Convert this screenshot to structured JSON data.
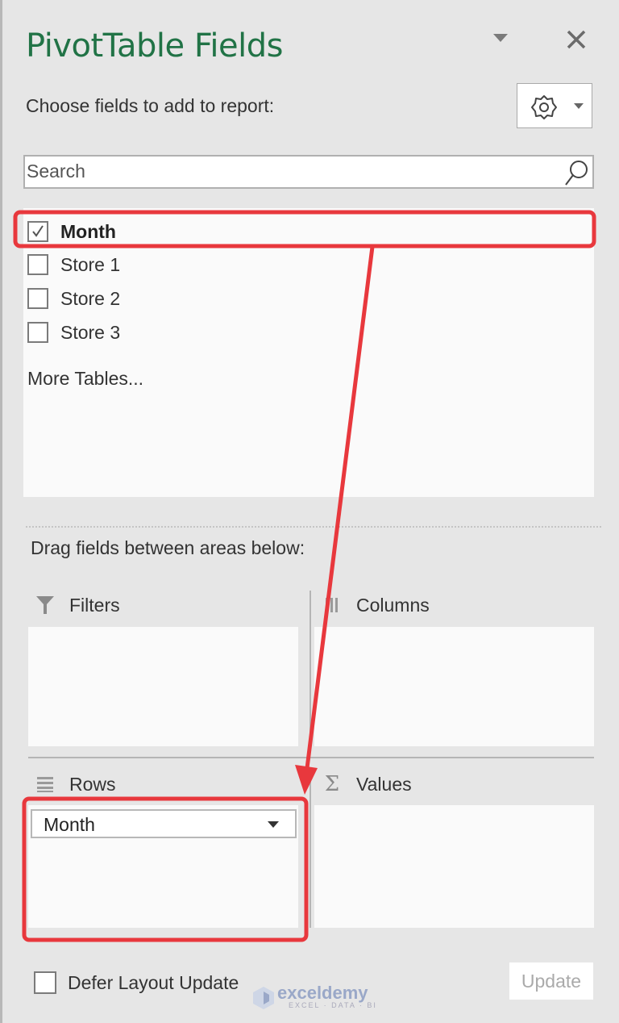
{
  "panel": {
    "title": "PivotTable Fields",
    "choose_label": "Choose fields to add to report:",
    "search": {
      "placeholder": "Search",
      "value": ""
    }
  },
  "fields": [
    {
      "label": "Month",
      "checked": true
    },
    {
      "label": "Store 1",
      "checked": false
    },
    {
      "label": "Store 2",
      "checked": false
    },
    {
      "label": "Store 3",
      "checked": false
    }
  ],
  "more_tables": "More Tables...",
  "drag_label": "Drag fields between areas below:",
  "areas": {
    "filters": {
      "label": "Filters",
      "items": []
    },
    "columns": {
      "label": "Columns",
      "items": []
    },
    "rows": {
      "label": "Rows",
      "items": [
        "Month"
      ]
    },
    "values": {
      "label": "Values",
      "items": []
    }
  },
  "footer": {
    "defer_label": "Defer Layout Update",
    "defer_checked": false,
    "update_label": "Update"
  },
  "watermark": {
    "brand": "exceldemy",
    "tagline": "EXCEL · DATA · BI"
  },
  "colors": {
    "title": "#217346",
    "annotation": "#e8383d"
  }
}
